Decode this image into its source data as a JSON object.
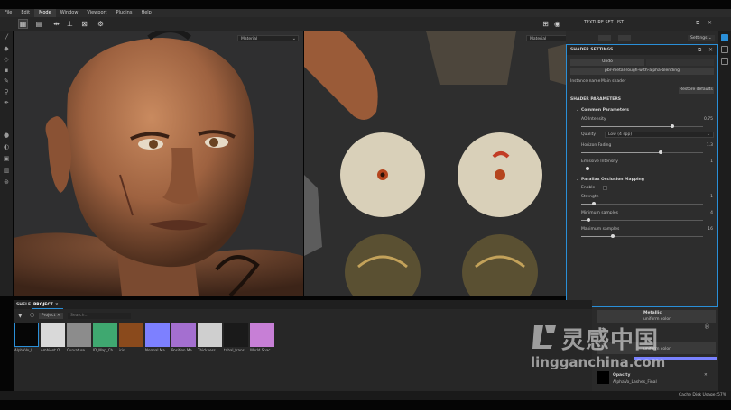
{
  "menubar": {
    "items": [
      "File",
      "Edit",
      "Mode",
      "Window",
      "Viewport",
      "Plugins",
      "Help"
    ],
    "active": "Mode"
  },
  "viewport3d": {
    "material_select": "Material"
  },
  "viewport2d": {
    "material_select": "Material"
  },
  "texture_set_list": {
    "title": "TEXTURE SET LIST",
    "settings_label": "Settings"
  },
  "shader_settings": {
    "title": "SHADER SETTINGS",
    "undo_label": "Undo",
    "shader_button": "pbr-metal-rough-with-alpha-blending",
    "instance_name_label": "Instance name",
    "instance_name_value": "Main shader",
    "restore_defaults_label": "Restore defaults",
    "section_title": "SHADER PARAMETERS",
    "common_group": "Common Parameters",
    "ao_label": "AO Intensity",
    "ao_value": "0.75",
    "ao_fraction": 0.75,
    "quality_label": "Quality",
    "quality_value": "Low (4 spp)",
    "horizon_label": "Horizon Fading",
    "horizon_value": "1.3",
    "horizon_fraction": 0.65,
    "emissive_label": "Emissive Intensity",
    "emissive_value": "1",
    "emissive_fraction": 0.05,
    "pom_group": "Parallax Occlusion Mapping",
    "enable_label": "Enable",
    "strength_label": "Strength",
    "strength_value": "1",
    "strength_fraction": 0.1,
    "min_samples_label": "Minimum samples",
    "min_samples_value": "4",
    "min_samples_fraction": 0.06,
    "max_samples_label": "Maximum samples",
    "max_samples_value": "16",
    "max_samples_fraction": 0.26
  },
  "shelf": {
    "tab_shelf": "SHELF",
    "tab_project": "PROJECT",
    "filter_tag": "Project",
    "search_placeholder": "Search...",
    "items": [
      {
        "label": "AlphaVo_L...",
        "color": "#060606"
      },
      {
        "label": "Ambient O...",
        "color": "#d9d9d9"
      },
      {
        "label": "Curvature ...",
        "color": "#8c8c8c"
      },
      {
        "label": "ID_Map_Ch...",
        "color": "#3fa870"
      },
      {
        "label": "iris",
        "color": "#8a4a1c"
      },
      {
        "label": "Normal Ma...",
        "color": "#7d80ff"
      },
      {
        "label": "Position Ma...",
        "color": "#a46fd0"
      },
      {
        "label": "Thickness ...",
        "color": "#cfcfcf"
      },
      {
        "label": "tribal_trans",
        "color": "#1a1a1a"
      },
      {
        "label": "World Spac...",
        "color": "#c77fd6"
      }
    ]
  },
  "props": {
    "metallic_label": "Metallic",
    "metallic_sub": "uniform color",
    "color_sub": "uniform color",
    "opacity_label": "Opacity",
    "opacity_value": "AlphaVo_Lashes_Final"
  },
  "status": {
    "cache_label": "Cache Disk Usage:",
    "cache_value": "57%"
  },
  "watermark": {
    "chinese": "灵感中国",
    "site": "lingganchina.com",
    "registered": "®"
  },
  "colors": {
    "accent": "#2a8fd8",
    "panel": "#2d2d2d",
    "skin": "#a86a45"
  }
}
